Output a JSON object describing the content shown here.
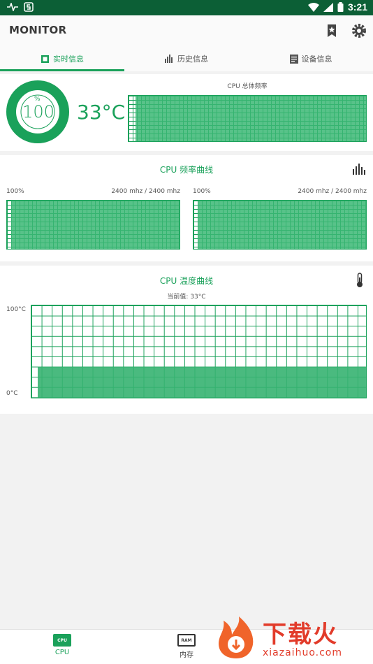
{
  "status_bar": {
    "time": "3:21"
  },
  "app": {
    "title": "MONITOR"
  },
  "tabs": [
    {
      "label": "实时信息"
    },
    {
      "label": "历史信息"
    },
    {
      "label": "设备信息"
    }
  ],
  "realtime": {
    "gauge_unit": "%",
    "gauge_value": "100",
    "gauge_level": 1.0,
    "temperature": "33°C",
    "overall_freq_label": "CPU 总体频率",
    "overall_freq_level": 0.97
  },
  "freq_curve": {
    "title": "CPU 频率曲线",
    "cores": [
      {
        "percent": "100%",
        "freq": "2400 mhz / 2400 mhz",
        "level": 1.0
      },
      {
        "percent": "100%",
        "freq": "2400 mhz / 2400 mhz",
        "level": 1.0
      }
    ]
  },
  "temp_curve": {
    "title": "CPU 温度曲线",
    "current": "当前值: 33°C",
    "y_max_label": "100°C",
    "y_min_label": "0°C",
    "level": 0.33
  },
  "bottom_nav": [
    {
      "chip": "CPU",
      "label": "CPU"
    },
    {
      "chip": "RAM",
      "label": "内存"
    }
  ],
  "watermark": {
    "brand": "下载火",
    "url": "xiazaihuo.com"
  },
  "colors": {
    "accent": "#1aa15a",
    "status_bar": "#0c5f36",
    "fill": "#3bb774"
  },
  "icons": [
    "bookmark-icon",
    "settings-icon",
    "chip-icon",
    "bar-chart-icon",
    "device-info-icon",
    "thermometer-icon"
  ]
}
